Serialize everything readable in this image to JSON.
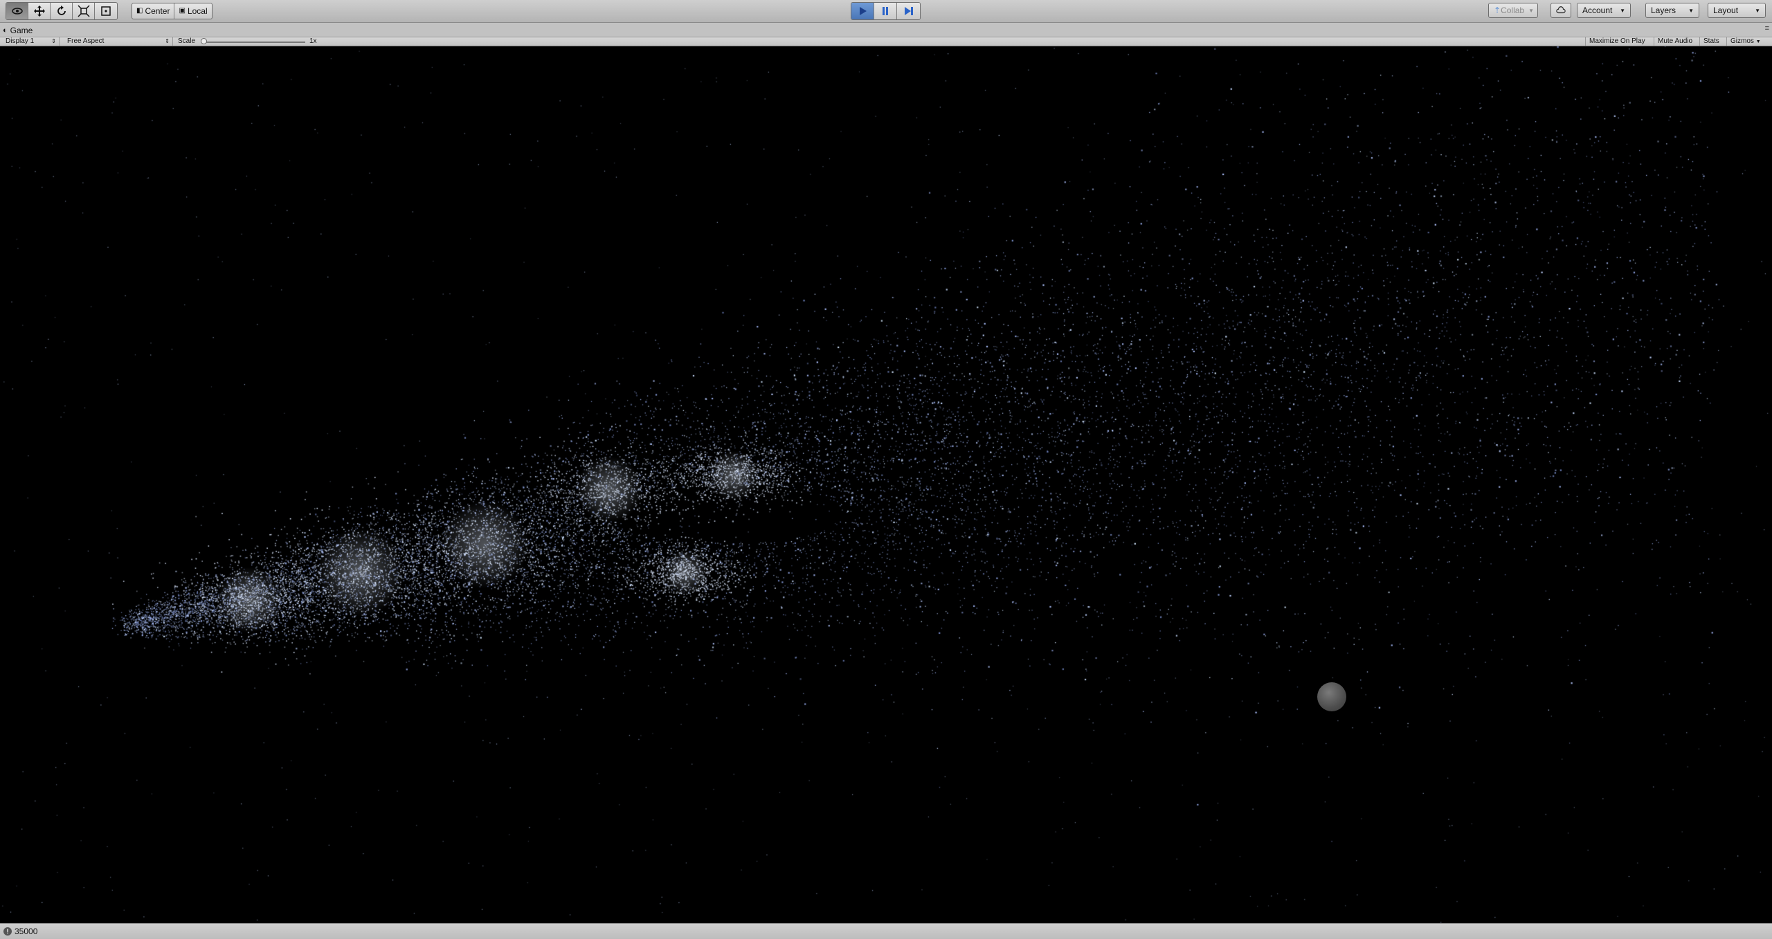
{
  "toolbar": {
    "pivot_center": "Center",
    "pivot_local": "Local",
    "collab": "Collab",
    "account": "Account",
    "layers": "Layers",
    "layout": "Layout",
    "tools": [
      "view-hand",
      "move",
      "rotate",
      "scale",
      "rect"
    ],
    "play_active_color": "#4a76b7"
  },
  "tab": {
    "title": "Game"
  },
  "gamebar": {
    "display": "Display 1",
    "aspect": "Free Aspect",
    "scale_label": "Scale",
    "scale_value": "1x",
    "maximize": "Maximize On Play",
    "mute": "Mute Audio",
    "stats": "Stats",
    "gizmos": "Gizmos"
  },
  "scene": {
    "particle_color": "#b9cbf2",
    "background": "#000000"
  },
  "status": {
    "text": "35000"
  }
}
